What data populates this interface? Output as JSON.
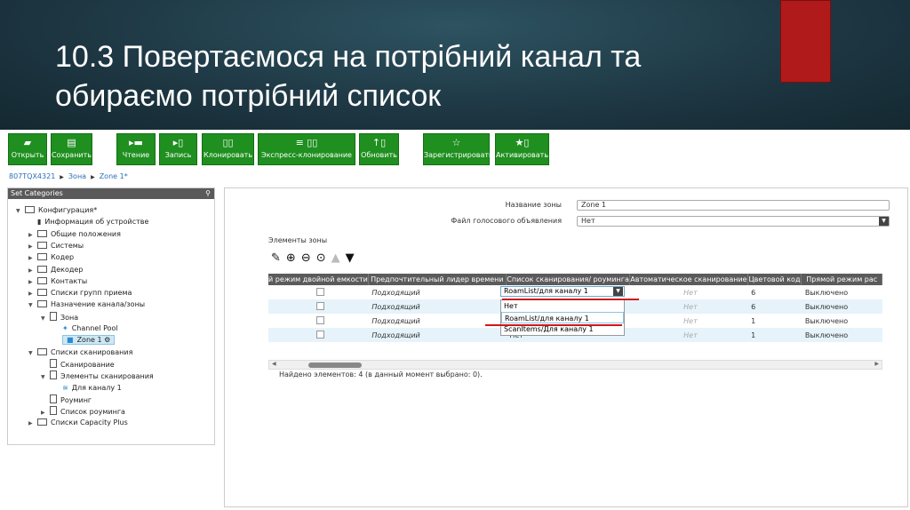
{
  "slide": {
    "title_line1": "10.3 Повертаємося на потрібний канал та",
    "title_line2": "обираємо потрібний список"
  },
  "toolbar": [
    {
      "icon": "▰",
      "label": "Открыть"
    },
    {
      "icon": "▤",
      "label": "Сохранить"
    },
    {
      "icon": "▸▬",
      "label": "Чтение"
    },
    {
      "icon": "▸▯",
      "label": "Запись"
    },
    {
      "icon": "▯▯",
      "label": "Клонировать"
    },
    {
      "icon": "≡ ▯▯",
      "label": "Экспресс-клонирование"
    },
    {
      "icon": "↑▯",
      "label": "Обновить"
    },
    {
      "icon": "☆",
      "label": "Зарегистрировать"
    },
    {
      "icon": "★▯",
      "label": "Активировать"
    }
  ],
  "breadcrumb": [
    "807TQX4321",
    "Зона",
    "Zone 1*"
  ],
  "left_panel": {
    "title": "Set Categories",
    "pin": "⚲",
    "tree": [
      "Конфигурация*",
      "Информация об устройстве",
      "Общие положения",
      "Системы",
      "Кодер",
      "Декодер",
      "Контакты",
      "Списки групп приема",
      "Назначение канала/зоны",
      "Зона",
      "Channel Pool",
      "Zone 1",
      "Списки сканирования",
      "Сканирование",
      "Элементы сканирования",
      "Для каналу 1",
      "Роуминг",
      "Список роуминга",
      "Списки Capacity Plus"
    ]
  },
  "form": {
    "zone_name_label": "Название зоны",
    "zone_name_value": "Zone 1",
    "voice_file_label": "Файл голосового объявления",
    "voice_file_value": "Нет"
  },
  "elements_label": "Элементы зоны",
  "table": {
    "headers": [
      "й режим двойной емкости",
      "Предпочтительный лидер времени",
      "Список сканирования/ роуминга",
      "Автоматическое сканирование",
      "Цветовой код",
      "Прямой режим рас"
    ],
    "rows": [
      {
        "leader": "Подходящий",
        "scan": "RoamList/для каналу 1",
        "auto": "Нет",
        "color": "6",
        "direct": "Выключено"
      },
      {
        "leader": "Подходящий",
        "scan": "",
        "auto": "Нет",
        "color": "6",
        "direct": "Выключено"
      },
      {
        "leader": "Подходящий",
        "scan": "",
        "auto": "Нет",
        "color": "1",
        "direct": "Выключено"
      },
      {
        "leader": "Подходящий",
        "scan": "Нет",
        "auto": "Нет",
        "color": "1",
        "direct": "Выключено"
      }
    ]
  },
  "dropdown_options": [
    "Нет",
    "RoamList/для каналу 1",
    "ScanItems/Для каналу 1"
  ],
  "status": "Найдено элементов: 4 (в данный момент выбрано: 0).",
  "colors": {
    "toolbar_green": "#1f8f1f",
    "accent_red": "#d01818",
    "header_bg": "#1d3642"
  }
}
